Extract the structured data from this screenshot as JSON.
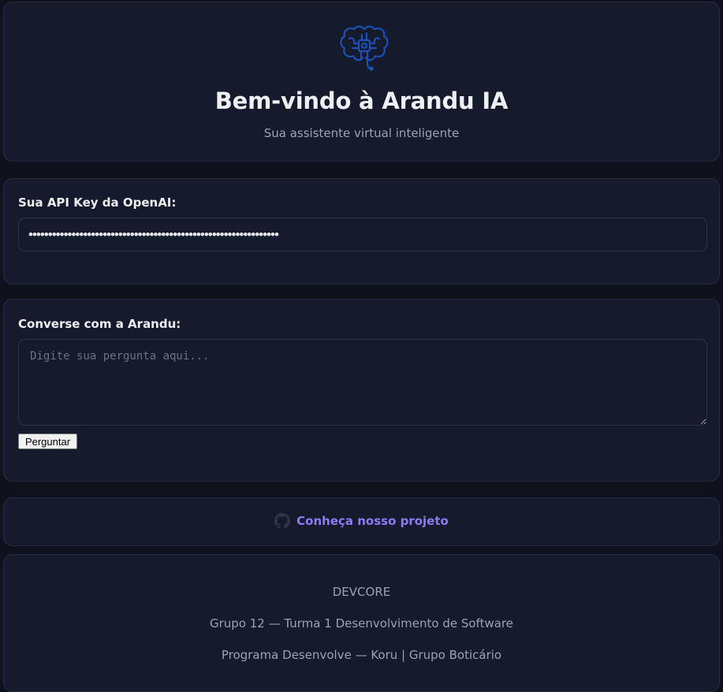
{
  "hero": {
    "logo_icon": "brain-chip-icon",
    "title": "Bem-vindo à Arandu IA",
    "subtitle": "Sua assistente virtual inteligente"
  },
  "api_key": {
    "label": "Sua API Key da OpenAI:",
    "value": "sk-proj-OpenAIKeyMaskedValuePlaceholderForArandu0000000000000000"
  },
  "chat": {
    "label": "Converse com a Arandu:",
    "placeholder": "Digite sua pergunta aqui...",
    "value": "",
    "button_label": "Perguntar"
  },
  "project_link": {
    "icon": "github-icon",
    "label": "Conheça nosso projeto"
  },
  "footer": {
    "brand": "DEVCORE",
    "group": "Grupo 12 — Turma 1 Desenvolvimento de Software",
    "program": "Programa Desenvolve — Koru | Grupo Boticário"
  },
  "colors": {
    "background": "#0e121c",
    "card": "#151b2d",
    "border": "#252c3f",
    "accent_link": "#8b7cf6",
    "logo_blue": "#1d4fb8",
    "muted_text": "#9ca3af"
  }
}
